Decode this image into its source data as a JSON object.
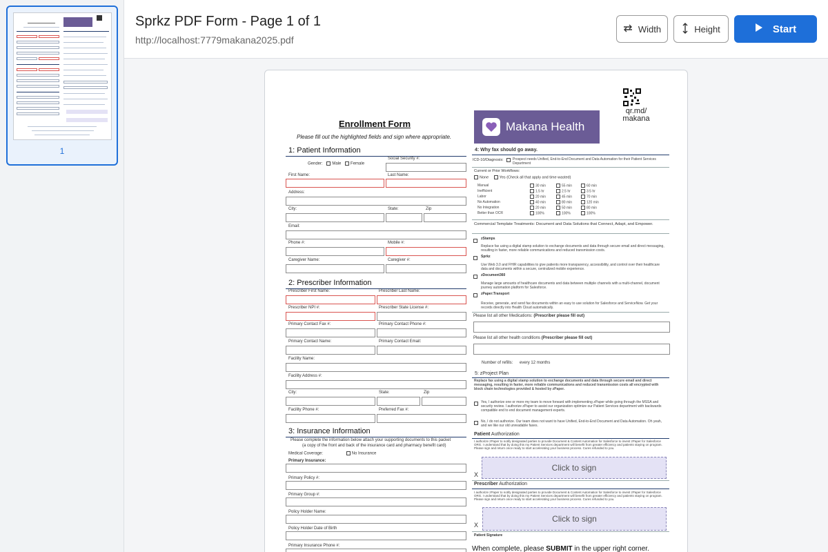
{
  "sidebar": {
    "page_number": "1"
  },
  "header": {
    "title": "Sprkz PDF Form - Page 1 of 1",
    "url": "http://localhost:7779makana2025.pdf",
    "width_label": "Width",
    "height_label": "Height",
    "start_label": "Start"
  },
  "form": {
    "title": "Enrollment Form",
    "subtitle": "Please fill out the highlighted fields and sign where appropriate.",
    "brand": "Makana Health",
    "qr_text": "qr.md/ makana",
    "s1": "1: Patient Information",
    "gender": "Gender:",
    "male": "Male",
    "female": "Female",
    "ssn": "Social Security #:",
    "first_name": "First Name:",
    "last_name": "Last Name:",
    "address": "Address:",
    "city": "City:",
    "state": "State:",
    "zip": "Zip",
    "email": "Email:",
    "phone": "Phone #:",
    "mobile": "Mobile #:",
    "caregiver_name": "Caregiver Name:",
    "caregiver_num": "Caregiver #:",
    "s2": "2: Prescriber Information",
    "pres_first": "Prescriber First Name:",
    "pres_last": "Prescriber Last Name:",
    "pres_npi": "Prescriber NPI #:",
    "pres_license": "Prescriber State License #:",
    "contact_fax": "Primary Contact Fax #:",
    "contact_phone": "Primary Contact Phone #:",
    "contact_name": "Primary Contact Name:",
    "contact_email": "Primary Contact Email:",
    "facility_name": "Facility Name:",
    "facility_address": "Facility Address #:",
    "city2": "City:",
    "state2": "State:",
    "zip2": "Zip",
    "facility_phone": "Facility Phone #:",
    "preferred_fax": "Preferred Fax #:",
    "s3": "3: Insurance Information",
    "ins_note": "Please complete the information below attach your supporting documents to this packet",
    "ins_note2": "(a copy of the front and back of the insurance card and pharmacy benefit card)",
    "medical_coverage": "Medical Coverage:",
    "no_insurance": "No Insurance",
    "primary_insurance": "Primary Insurance:",
    "primary_policy": "Primary Policy #:",
    "primary_group": "Primary Group #:",
    "policy_holder": "Policy Holder Name:",
    "policy_dob": "Policy Holder Date of Birth",
    "ins_phone": "Primary Insurance Phone #:",
    "s4": "4: Why fax should go away.",
    "icd": "ICD-10/Diagnosis:",
    "icd_text": "Prospect needs Unified, End-to-End Document and Data Automation for their Patient Services Department",
    "workflows": "Current or Prior Workflows:",
    "none": "None",
    "yes_check": "Yes (Check all that apply and time wasted)",
    "rows": [
      "Manual",
      "Inefficient",
      "Labor",
      "No Automation",
      "No Integration",
      "Better than OCR"
    ],
    "col1": [
      "30 min",
      "1.5 hr",
      "20 min",
      "40 min",
      "20 min",
      "100%"
    ],
    "col2": [
      "55 min",
      "2.5 hr",
      "45 min",
      "80 min",
      "50 min",
      "100%"
    ],
    "col3": [
      "60 min",
      "3.5 hr",
      "70 min",
      "120 min",
      "80 min",
      "100%"
    ],
    "commercial": "Commercial Template Treatments: Document and Data Solutions that Connect, Adapt, and Empower.",
    "opt1": "zStamps",
    "opt1_desc": "Replace fax using a digital stamp solution to exchange documents and data through secure email and direct messaging, resulting in faster, more reliable communications and reduced transmission costs.",
    "opt2": "Sprkz",
    "opt2_desc": "Use Web 3.0 and FHIR capabilities to give patients more transparency, accessibility, and control over their healthcare data and documents within a secure, centralized mobile experience.",
    "opt3": "zDocument360",
    "opt3_desc": "Manage large amounts of healthcare documents and data between multiple channels with a multi-channel, document journey automation platform for Salesforce.",
    "opt4": "zPaper:Transport",
    "opt4_desc": "Receive, generate, and send fax documents within an easy to use solution for Salesforce and ServiceNow. Get your records directly into Health Cloud automatically.",
    "meds": "Please list all other Medications:",
    "meds_bold": "(Prescriber please fill out)",
    "conditions": "Please list all other health conditions",
    "conditions_bold": "(Prescriber please fill out)",
    "refills": "Number of refills:",
    "refills_val": "every 12 months",
    "s5": "5: zProject Plan",
    "plan_text": "Replace fax using a digital stamp solution to exchange documents and data through secure email and direct messaging, resulting in faster, more reliable communications and reduced transmission costs all encrypted with block chain technologies provided & hosted by zPaper.",
    "yes_plan": "Yes, I authorize one or more my team to move forward with implementing zPaper while going through the MSSA and security review. I authorize zPaper to assist our organization optimize our Patient Services department with backwards compatible end to end document management experts.",
    "no_plan": "No, I do not authorize. Our team does not want to have Unified, End-to-End Document and Data Automation. Oh yeah, and we like our old unreadable faxes.",
    "patient_auth": "Patient",
    "auth_word": "Authorization",
    "auth_text": "I authorize zPaper to notify designated parties to provide Document & Content Automation for Salesforce to invest zPaper for Salesforce ORG. I understand that by doing this my Patient Services department will benefit from greater efficiency and patients staying on program. Please sign and return once ready to start accelerating your business process. Cures refunded to you.",
    "sign_x": "X",
    "click_to_sign": "Click to sign",
    "prescriber_auth": "Prescriber",
    "patient_signature": "Patient Signature",
    "submit_pre": "When complete, please",
    "submit_bold": "SUBMIT",
    "submit_post": "in the upper right corner."
  },
  "colors": {
    "accent": "#1e6fd9",
    "brand_bg": "#6b5c96",
    "required": "#d9534f",
    "sign_bg": "#e4e2f5"
  }
}
